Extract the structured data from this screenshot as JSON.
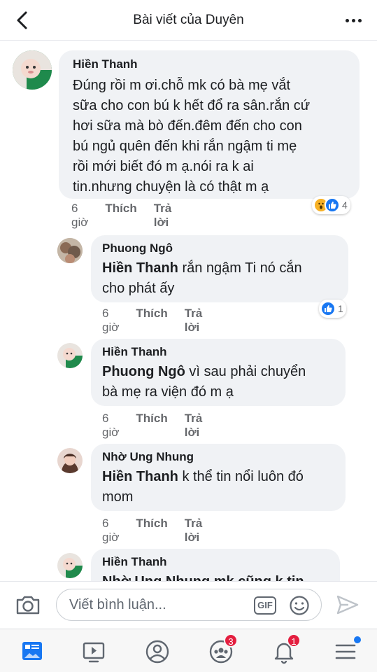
{
  "header": {
    "title": "Bài viết của Duyên"
  },
  "comments": [
    {
      "author": "Hiền Thanh",
      "text": "Đúng rồi m ơi.chỗ mk có bà mẹ vắt sữa cho con bú k hết đổ ra sân.rắn cứ hơi sữa mà bò đến.đêm đến cho con bú ngủ quên đến khi rắn ngậm ti mẹ rồi mới biết đó m ạ.nói ra k ai tin.nhưng chuyện là có thật m ạ",
      "lines": [
        "Đúng rồi m ơi.chỗ mk có bà mẹ vắt",
        "sữa cho con bú k hết đổ ra sân.rắn cứ",
        "hơi sữa mà bò đến.đêm đến cho con",
        "bú ngủ quên đến khi rắn ngậm ti mẹ",
        "rồi mới biết đó m ạ.nói ra k ai",
        "tin.nhưng chuyện là có thật m ạ"
      ],
      "time": "6 giờ",
      "like": "Thích",
      "reply": "Trả lời",
      "reaction_count": "4"
    },
    {
      "author": "Phuong Ngô",
      "mention": "Hiền Thanh",
      "line1_rest": " rắn ngậm Ti  nó cắn",
      "line2": "cho  phát  ấy",
      "time": "6 giờ",
      "like": "Thích",
      "reply": "Trả lời",
      "reaction_count": "1"
    },
    {
      "author": "Hiền Thanh",
      "mention": "Phuong Ngô",
      "line1_rest": " vì sau phải chuyển",
      "line2": "bà mẹ ra viện đó m ạ",
      "time": "6 giờ",
      "like": "Thích",
      "reply": "Trả lời"
    },
    {
      "author": "Nhờ Ung Nhung",
      "mention": "Hiền Thanh",
      "line1_rest": " k thể tin nổi luôn đó",
      "line2": "mom",
      "time": "6 giờ",
      "like": "Thích",
      "reply": "Trả lời"
    },
    {
      "author": "Hiền Thanh",
      "partial": "Nhờ Ung Nhung mk cũng k tin"
    }
  ],
  "composer": {
    "placeholder": "Viết bình luận...",
    "gif_label": "GIF"
  },
  "tabbar": {
    "items": [
      {
        "name": "news-feed-icon"
      },
      {
        "name": "watch-icon"
      },
      {
        "name": "profile-icon"
      },
      {
        "name": "groups-icon",
        "badge": "3"
      },
      {
        "name": "notifications-icon",
        "badge": "1"
      },
      {
        "name": "menu-icon"
      }
    ]
  },
  "colors": {
    "accent": "#1877f2",
    "badge": "#e41e3f",
    "bubble": "#f0f2f5"
  }
}
